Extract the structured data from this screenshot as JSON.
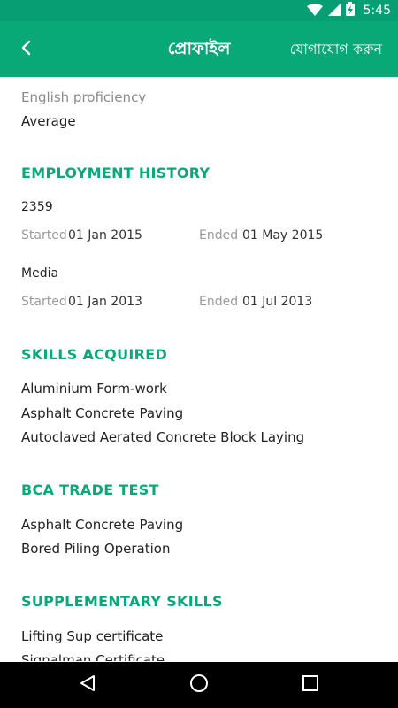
{
  "status_bar": {
    "time": "5:45",
    "icons": [
      "wifi-icon",
      "cell-signal-icon",
      "battery-charging-icon"
    ]
  },
  "app_bar": {
    "back_icon": "chevron-left-icon",
    "title": "প্রোফাইল",
    "contact_label": "যোগাযোগ করুন",
    "background": "#08a977"
  },
  "profile": {
    "english_proficiency": {
      "label": "English proficiency",
      "value": "Average"
    },
    "employment_history": {
      "title": "EMPLOYMENT HISTORY",
      "entries": [
        {
          "employer": "2359",
          "started_label": "Started",
          "started": "01 Jan 2015",
          "ended_label": "Ended",
          "ended": "01 May 2015"
        },
        {
          "employer": "Media",
          "started_label": "Started",
          "started": "01 Jan 2013",
          "ended_label": "Ended",
          "ended": "01 Jul 2013"
        }
      ]
    },
    "skills_acquired": {
      "title": "SKILLS ACQUIRED",
      "items": [
        "Aluminium Form-work",
        "Asphalt Concrete Paving",
        "Autoclaved Aerated Concrete Block Laying"
      ]
    },
    "bca_trade_test": {
      "title": "BCA TRADE TEST",
      "items": [
        "Asphalt Concrete Paving",
        "Bored Piling Operation"
      ]
    },
    "supplementary_skills": {
      "title": "SUPPLEMENTARY SKILLS",
      "items": [
        "Lifting Sup certificate",
        "Signalman Certificate"
      ]
    }
  },
  "nav_bar": {
    "buttons": [
      "back-triangle-icon",
      "home-circle-icon",
      "recents-square-icon"
    ]
  },
  "colors": {
    "accent": "#08a977",
    "status_bar": "#069e72",
    "nav_bar": "#000000"
  }
}
